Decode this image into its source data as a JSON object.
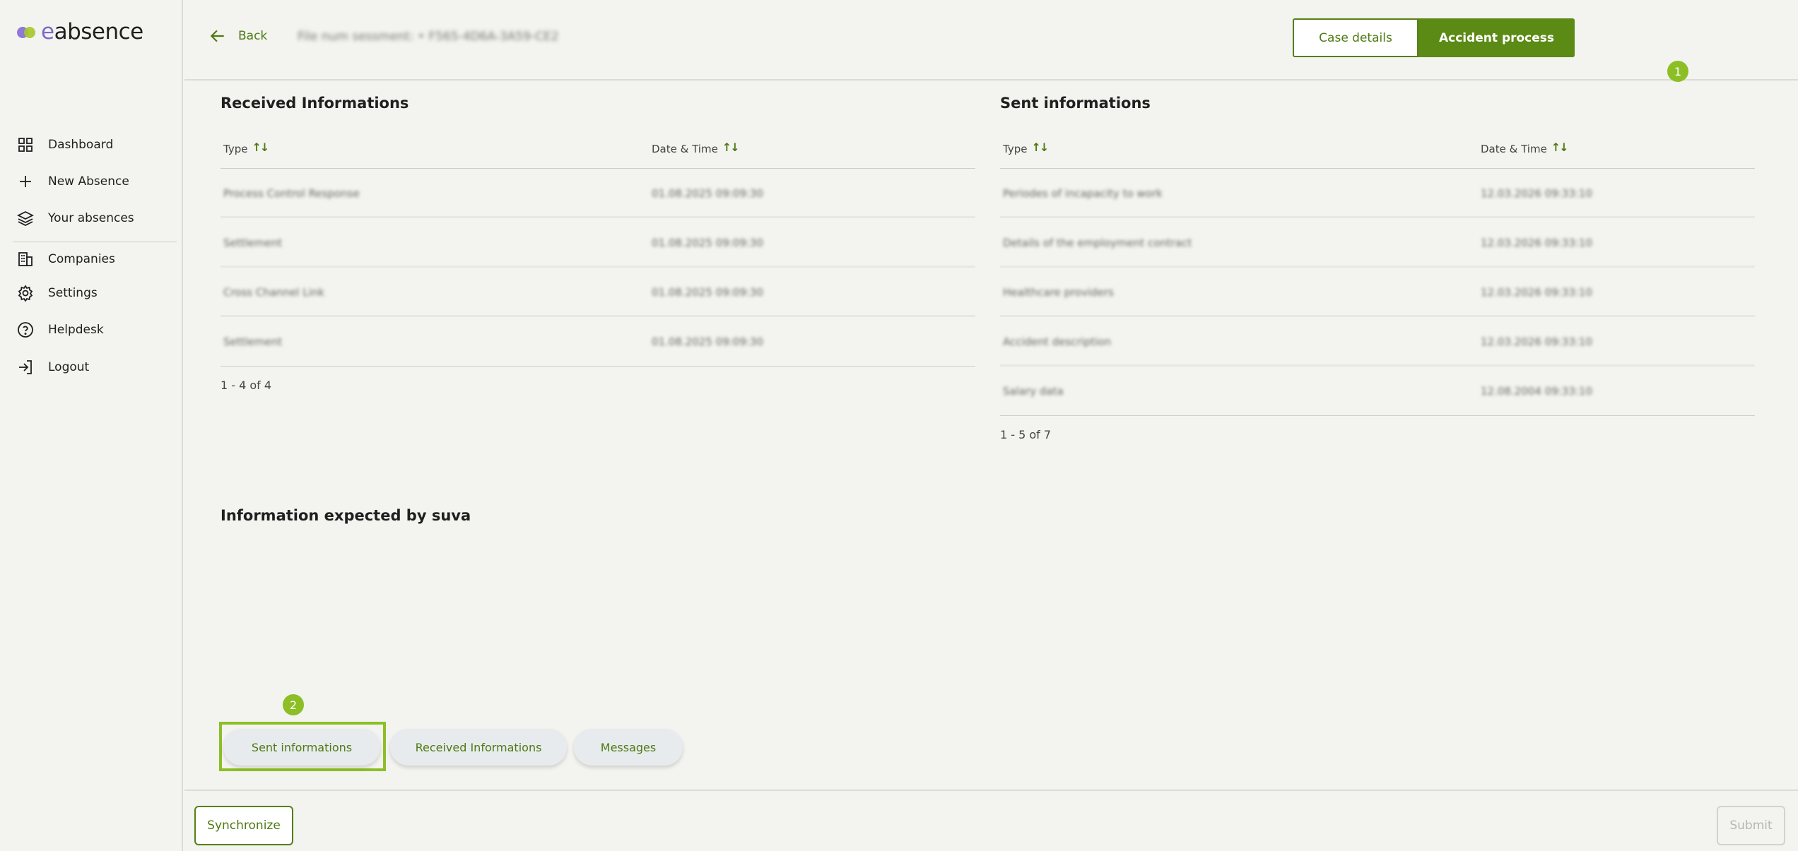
{
  "app": {
    "logo_prefix": "e",
    "logo_rest": "absence"
  },
  "sidebar": {
    "items": [
      {
        "label": "Dashboard",
        "icon": "grid-icon"
      },
      {
        "label": "New Absence",
        "icon": "plus-icon"
      },
      {
        "label": "Your absences",
        "icon": "layers-icon"
      },
      {
        "label": "Companies",
        "icon": "building-icon"
      },
      {
        "label": "Settings",
        "icon": "gear-icon"
      },
      {
        "label": "Helpdesk",
        "icon": "help-icon"
      },
      {
        "label": "Logout",
        "icon": "logout-icon"
      }
    ]
  },
  "header": {
    "back_label": "Back",
    "case_identifier": "File num sessment: • F565-4D6A-3A59-CE2",
    "case_details_label": "Case details",
    "accident_process_label": "Accident process",
    "badge_1": "1"
  },
  "received": {
    "title": "Received Informations",
    "col_type": "Type",
    "col_datetime": "Date & Time",
    "rows": [
      {
        "type": "Process Control Response",
        "datetime": "01.08.2025 09:09:30"
      },
      {
        "type": "Settlement",
        "datetime": "01.08.2025 09:09:30"
      },
      {
        "type": "Cross Channel Link",
        "datetime": "01.08.2025 09:09:30"
      },
      {
        "type": "Settlement",
        "datetime": "01.08.2025 09:09:30"
      }
    ],
    "pager": "1 - 4 of 4"
  },
  "sent": {
    "title": "Sent informations",
    "col_type": "Type",
    "col_datetime": "Date & Time",
    "rows": [
      {
        "type": "Periodes of incapacity to work",
        "datetime": "12.03.2026 09:33:10"
      },
      {
        "type": "Details of the employment contract",
        "datetime": "12.03.2026 09:33:10"
      },
      {
        "type": "Healthcare providers",
        "datetime": "12.03.2026 09:33:10"
      },
      {
        "type": "Accident description",
        "datetime": "12.03.2026 09:33:10"
      },
      {
        "type": "Salary data",
        "datetime": "12.08.2004 09:33:10"
      }
    ],
    "pager": "1 - 5 of 7"
  },
  "expected": {
    "title": "Information expected by suva"
  },
  "tabs": {
    "badge_2": "2",
    "sent_label": "Sent informations",
    "received_label": "Received Informations",
    "messages_label": "Messages"
  },
  "footer": {
    "sync_label": "Synchronize",
    "submit_label": "Submit"
  },
  "colors": {
    "accent": "#5b8a15",
    "highlight": "#8cbf26",
    "background": "#f3f3ef"
  }
}
